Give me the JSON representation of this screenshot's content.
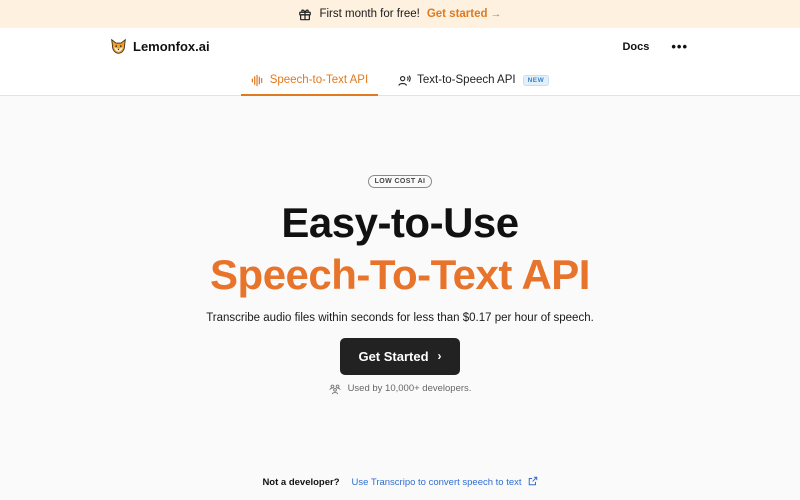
{
  "promo": {
    "text": "First month for free!",
    "cta": "Get started",
    "icon": "gift-icon",
    "accent": "#e07a1f"
  },
  "header": {
    "brand": "Lemonfox.ai",
    "logo_icon": "fox-logo-icon",
    "docs": "Docs",
    "more": "•••"
  },
  "tabs": [
    {
      "label": "Speech-to-Text API",
      "icon": "audio-wave-icon",
      "active": true
    },
    {
      "label": "Text-to-Speech API",
      "icon": "speaking-person-icon",
      "badge": "NEW"
    }
  ],
  "hero": {
    "pill": "LOW COST AI",
    "title_line1": "Easy-to-Use",
    "title_line2": "Speech-To-Text API",
    "subtitle": "Transcribe audio files within seconds for less than $0.17 per hour of speech.",
    "button": "Get Started",
    "used_by": "Used by 10,000+ developers."
  },
  "footer": {
    "question": "Not a developer?",
    "link": "Use Transcripo to convert speech to text"
  },
  "colors": {
    "orange": "#e8732a",
    "dark_button": "#222222",
    "link_blue": "#2f6fd0"
  }
}
